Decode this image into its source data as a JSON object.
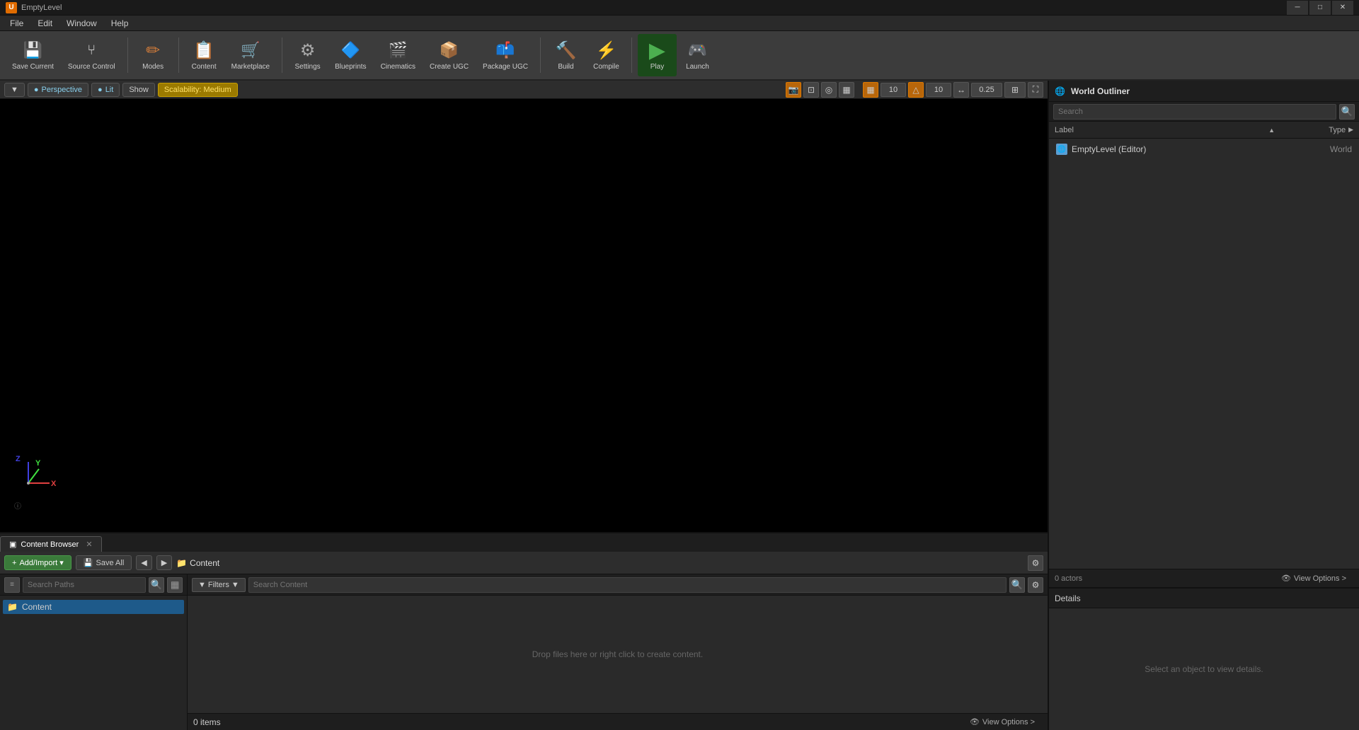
{
  "app": {
    "title": "EmptyLevel",
    "icon": "U"
  },
  "titlebar": {
    "minimize": "─",
    "maximize": "□",
    "close": "✕"
  },
  "menubar": {
    "items": [
      "File",
      "Edit",
      "Window",
      "Help"
    ]
  },
  "toolbar": {
    "buttons": [
      {
        "id": "save-current",
        "label": "Save Current",
        "icon": "💾",
        "class": "btn-save",
        "has_dropdown": true
      },
      {
        "id": "source-control",
        "label": "Source Control",
        "icon": "🔀",
        "class": "btn-source",
        "has_dropdown": true
      },
      {
        "id": "modes",
        "label": "Modes",
        "icon": "✏️",
        "class": "btn-modes",
        "has_dropdown": true
      },
      {
        "id": "content",
        "label": "Content",
        "icon": "📁",
        "class": "btn-content",
        "has_dropdown": false
      },
      {
        "id": "marketplace",
        "label": "Marketplace",
        "icon": "🛒",
        "class": "btn-marketplace",
        "has_dropdown": false
      },
      {
        "id": "settings",
        "label": "Settings",
        "icon": "⚙️",
        "class": "btn-settings",
        "has_dropdown": true
      },
      {
        "id": "blueprints",
        "label": "Blueprints",
        "icon": "🔷",
        "class": "btn-blueprints",
        "has_dropdown": true
      },
      {
        "id": "cinematics",
        "label": "Cinematics",
        "icon": "🎬",
        "class": "btn-cinematics",
        "has_dropdown": true
      },
      {
        "id": "create-ugc",
        "label": "Create UGC",
        "icon": "📦",
        "class": "btn-create-ugc",
        "has_dropdown": false
      },
      {
        "id": "package-ugc",
        "label": "Package UGC",
        "icon": "📫",
        "class": "btn-package-ugc",
        "has_dropdown": true
      },
      {
        "id": "build",
        "label": "Build",
        "icon": "🔨",
        "class": "btn-build",
        "has_dropdown": true
      },
      {
        "id": "compile",
        "label": "Compile",
        "icon": "⚡",
        "class": "btn-compile",
        "has_dropdown": false
      },
      {
        "id": "play",
        "label": "Play",
        "icon": "▶",
        "class": "btn-play",
        "has_dropdown": false
      },
      {
        "id": "launch",
        "label": "Launch",
        "icon": "🎮",
        "class": "btn-launch",
        "has_dropdown": true
      }
    ]
  },
  "viewport": {
    "perspective_label": "Perspective",
    "lit_label": "Lit",
    "show_label": "Show",
    "scalability_label": "Scalability: Medium",
    "grid_size": "10",
    "rotation_snap": "10",
    "scale_snap": "0.25",
    "icon_buttons": [
      "camera",
      "perspective-select",
      "realtime",
      "stat",
      "grid-snap",
      "rotation-snap",
      "grid-icon",
      "triangle-icon",
      "angle-icon",
      "move-icon",
      "scale-icon",
      "num4",
      "maximize"
    ]
  },
  "world_outliner": {
    "title": "World Outliner",
    "search_placeholder": "Search",
    "col_label": "Label",
    "col_type": "Type",
    "items": [
      {
        "label": "EmptyLevel (Editor)",
        "type": "World",
        "icon": "🌐"
      }
    ],
    "actor_count": "0 actors",
    "view_options_label": "View Options >"
  },
  "details": {
    "title": "Details",
    "empty_message": "Select an object to view details."
  },
  "content_browser": {
    "tab_label": "Content Browser",
    "add_import_label": "Add/Import ▾",
    "save_all_label": "Save All",
    "breadcrumb": "Content",
    "search_paths_placeholder": "Search Paths",
    "filters_label": "▾ Filters ▾",
    "search_content_placeholder": "Search Content",
    "source_items": [
      "Content"
    ],
    "items_count": "0 items",
    "view_options_label": "View Options >",
    "drop_message": "Drop files here or right click to create content."
  }
}
